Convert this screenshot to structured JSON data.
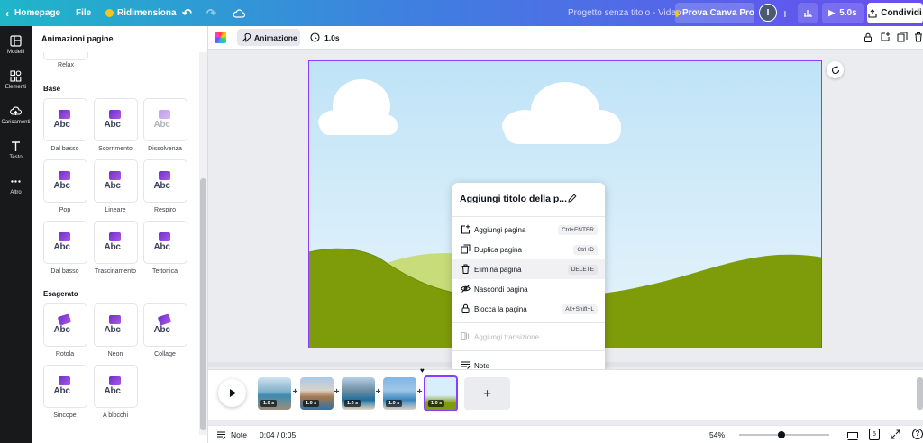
{
  "topbar": {
    "homepage": "Homepage",
    "file": "File",
    "resize": "Ridimensiona",
    "project_title": "Progetto senza titolo - Video",
    "pro_button": "Prova Canva Pro",
    "avatar_letter": "I",
    "duration_play": "5.0s",
    "share": "Condividi"
  },
  "rail": {
    "items": [
      "Modelli",
      "Elementi",
      "Caricamenti",
      "Testo",
      "Altro"
    ]
  },
  "panel": {
    "title": "Animazioni pagine",
    "relax": "Relax",
    "section_base": "Base",
    "base_items": [
      "Dal basso",
      "Scorrimento",
      "Dissolvenza",
      "Pop",
      "Lineare",
      "Respiro",
      "Dal basso",
      "Trascinamento",
      "Tettonica"
    ],
    "section_exaggerated": "Esagerato",
    "exaggerated_items": [
      "Rotola",
      "Neon",
      "Collage",
      "Sincope",
      "A blocchi"
    ],
    "card_text": "Abc"
  },
  "context_bar": {
    "animation": "Animazione",
    "duration": "1.0s"
  },
  "menu": {
    "title": "Aggiungi titolo della p...",
    "items": [
      {
        "label": "Aggiungi pagina",
        "shortcut": "Ctrl+ENTER"
      },
      {
        "label": "Duplica pagina",
        "shortcut": "Ctrl+D"
      },
      {
        "label": "Elimina pagina",
        "shortcut": "DELETE"
      },
      {
        "label": "Nascondi pagina",
        "shortcut": ""
      },
      {
        "label": "Blocca la pagina",
        "shortcut": "Alt+Shift+L"
      },
      {
        "label": "Aggiungi transizione",
        "shortcut": ""
      },
      {
        "label": "Note",
        "shortcut": ""
      }
    ]
  },
  "timeline": {
    "clips": [
      "1.0 s",
      "1.0 s",
      "1.0 s",
      "1.0 s",
      "1.0 s"
    ],
    "add": "+"
  },
  "bottombar": {
    "notes": "Note",
    "time": "0:04 / 0:05",
    "zoom": "54%",
    "page_count": "5"
  },
  "colors": {
    "accent": "#8b3dff",
    "hill_dark": "#7e9b0a",
    "hill_light": "#c8dc7a"
  }
}
